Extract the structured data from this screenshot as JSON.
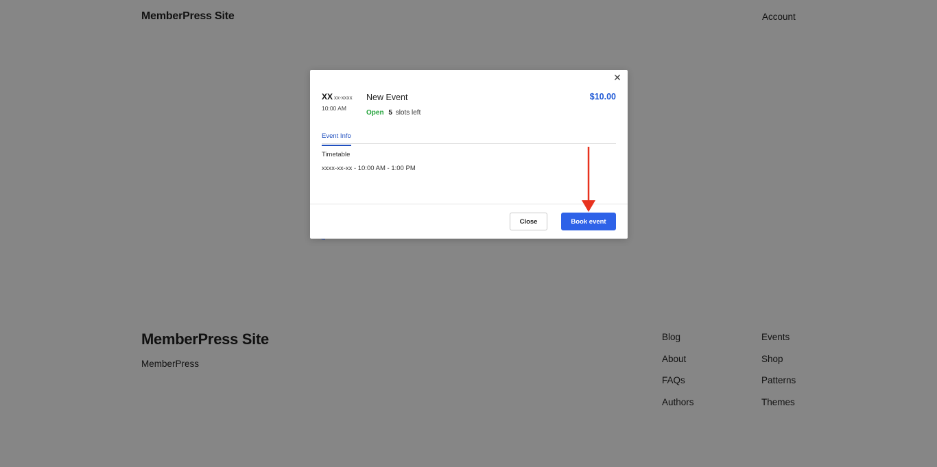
{
  "header": {
    "site_title": "MemberPress Site",
    "account_label": "Account"
  },
  "modal": {
    "close_icon": "close-icon",
    "date_day": "XX",
    "date_rest": "xx-xxxx",
    "time": "10:00 AM",
    "event_title": "New Event",
    "status": "Open",
    "slots_count": "5",
    "slots_suffix": "slots left",
    "price": "$10.00",
    "tab_label": "Event Info",
    "timetable_label": "Timetable",
    "timetable_value": "xxxx-xx-xx - 10:00 AM - 1:00 PM",
    "close_button": "Close",
    "book_button": "Book event",
    "colors": {
      "price": "#1f59d6",
      "open_status": "#22a33a",
      "primary_button": "#2e62e8",
      "annotation_arrow": "#e8321e"
    }
  },
  "footer": {
    "site_title": "MemberPress Site",
    "tagline": "MemberPress",
    "column1": [
      "Blog",
      "About",
      "FAQs",
      "Authors"
    ],
    "column2": [
      "Events",
      "Shop",
      "Patterns",
      "Themes"
    ]
  }
}
